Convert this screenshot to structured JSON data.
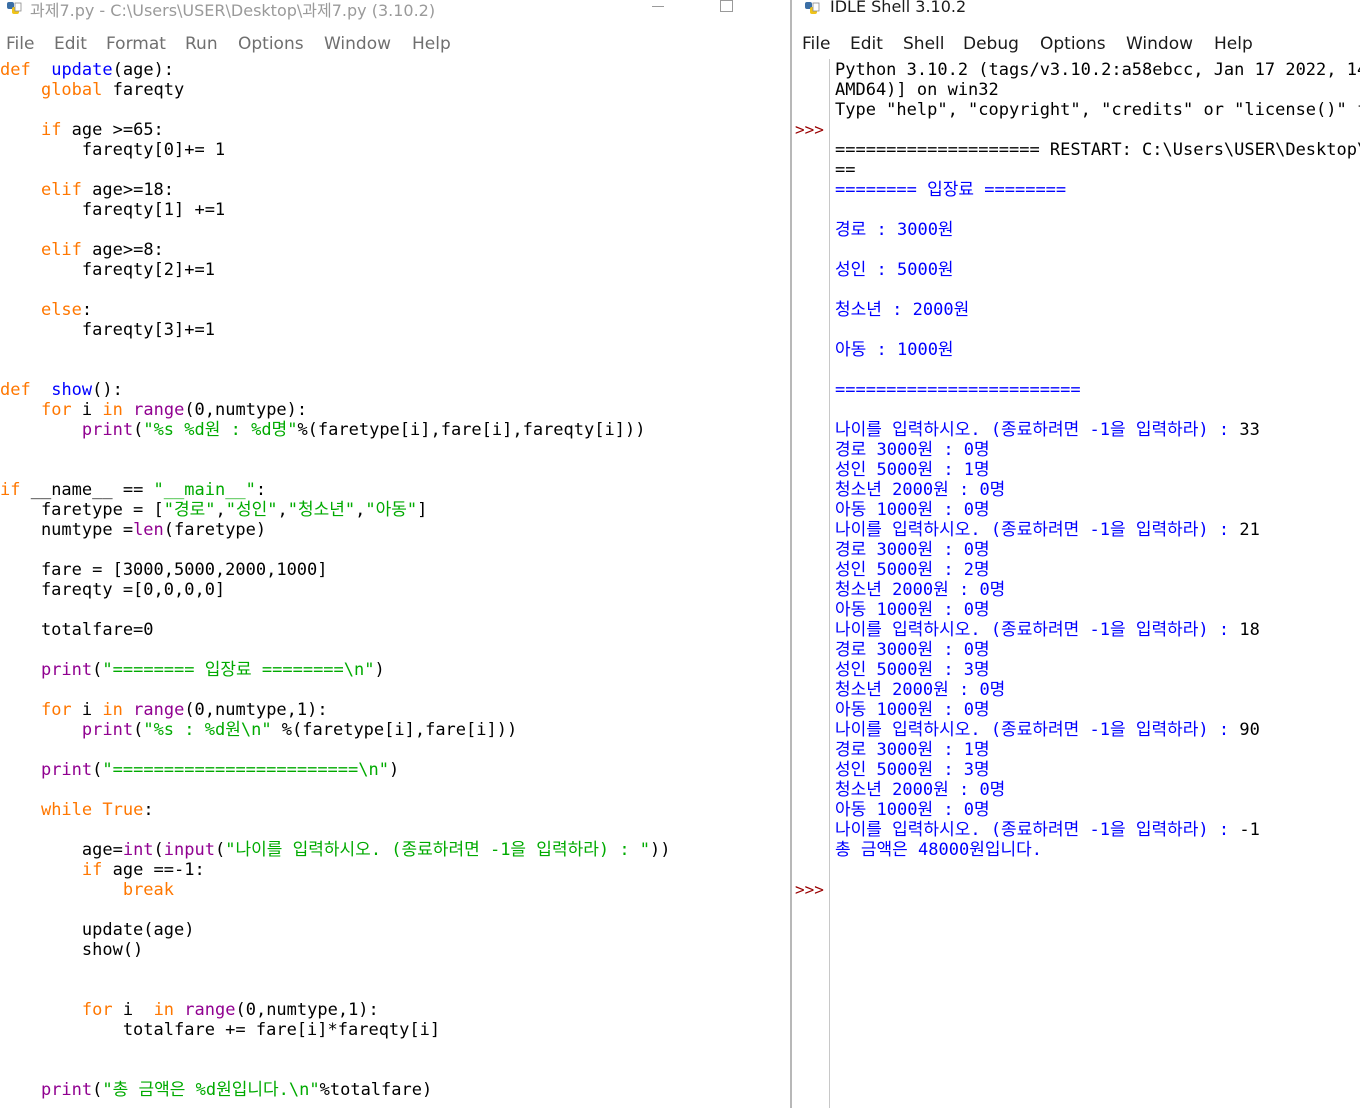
{
  "editor": {
    "title": "과제7.py - C:\\Users\\USER\\Desktop\\과제7.py (3.10.2)",
    "icon": "python-file-icon",
    "menu": [
      "File",
      "Edit",
      "Format",
      "Run",
      "Options",
      "Window",
      "Help"
    ],
    "code": [
      [
        [
          "k",
          "def"
        ],
        [
          "",
          "  "
        ],
        [
          "d",
          "update"
        ],
        [
          "",
          "(age):"
        ]
      ],
      [
        [
          "",
          "    "
        ],
        [
          "k",
          "global"
        ],
        [
          "",
          " fareqty"
        ]
      ],
      [],
      [
        [
          "",
          "    "
        ],
        [
          "k",
          "if"
        ],
        [
          "",
          " age >=65:"
        ]
      ],
      [
        [
          "",
          "        fareqty[0]+= 1"
        ]
      ],
      [],
      [
        [
          "",
          "    "
        ],
        [
          "k",
          "elif"
        ],
        [
          "",
          " age>=18:"
        ]
      ],
      [
        [
          "",
          "        fareqty[1] +=1"
        ]
      ],
      [],
      [
        [
          "",
          "    "
        ],
        [
          "k",
          "elif"
        ],
        [
          "",
          " age>=8:"
        ]
      ],
      [
        [
          "",
          "        fareqty[2]+=1"
        ]
      ],
      [],
      [
        [
          "",
          "    "
        ],
        [
          "k",
          "else"
        ],
        [
          "",
          ":"
        ]
      ],
      [
        [
          "",
          "        fareqty[3]+=1"
        ]
      ],
      [],
      [],
      [
        [
          "k",
          "def"
        ],
        [
          "",
          "  "
        ],
        [
          "d",
          "show"
        ],
        [
          "",
          "():"
        ]
      ],
      [
        [
          "",
          "    "
        ],
        [
          "k",
          "for"
        ],
        [
          "",
          " i "
        ],
        [
          "k",
          "in"
        ],
        [
          "",
          " "
        ],
        [
          "f",
          "range"
        ],
        [
          "",
          "(0,numtype):"
        ]
      ],
      [
        [
          "",
          "        "
        ],
        [
          "f",
          "print"
        ],
        [
          "",
          "("
        ],
        [
          "s",
          "\"%s %d원 : %d명\""
        ],
        [
          "",
          "%(faretype[i],fare[i],fareqty[i]))"
        ]
      ],
      [],
      [],
      [
        [
          "k",
          "if"
        ],
        [
          "",
          " __name__ == "
        ],
        [
          "s",
          "\"__main__\""
        ],
        [
          "",
          ":"
        ]
      ],
      [
        [
          "",
          "    faretype = ["
        ],
        [
          "s",
          "\"경로\""
        ],
        [
          "",
          ","
        ],
        [
          "s",
          "\"성인\""
        ],
        [
          "",
          ","
        ],
        [
          "s",
          "\"청소년\""
        ],
        [
          "",
          ","
        ],
        [
          "s",
          "\"아동\""
        ],
        [
          "",
          "]"
        ]
      ],
      [
        [
          "",
          "    numtype ="
        ],
        [
          "f",
          "len"
        ],
        [
          "",
          "(faretype)"
        ]
      ],
      [],
      [
        [
          "",
          "    fare = [3000,5000,2000,1000]"
        ]
      ],
      [
        [
          "",
          "    fareqty =[0,0,0,0]"
        ]
      ],
      [],
      [
        [
          "",
          "    totalfare=0"
        ]
      ],
      [],
      [
        [
          "",
          "    "
        ],
        [
          "f",
          "print"
        ],
        [
          "",
          "("
        ],
        [
          "s",
          "\"======== 입장료 ========\\n\""
        ],
        [
          "",
          ")"
        ]
      ],
      [],
      [
        [
          "",
          "    "
        ],
        [
          "k",
          "for"
        ],
        [
          "",
          " i "
        ],
        [
          "k",
          "in"
        ],
        [
          "",
          " "
        ],
        [
          "f",
          "range"
        ],
        [
          "",
          "(0,numtype,1):"
        ]
      ],
      [
        [
          "",
          "        "
        ],
        [
          "f",
          "print"
        ],
        [
          "",
          "("
        ],
        [
          "s",
          "\"%s : %d원\\n\""
        ],
        [
          "",
          " %(faretype[i],fare[i]))"
        ]
      ],
      [],
      [
        [
          "",
          "    "
        ],
        [
          "f",
          "print"
        ],
        [
          "",
          "("
        ],
        [
          "s",
          "\"========================\\n\""
        ],
        [
          "",
          ")"
        ]
      ],
      [],
      [
        [
          "",
          "    "
        ],
        [
          "k",
          "while"
        ],
        [
          "",
          " "
        ],
        [
          "k",
          "True"
        ],
        [
          "",
          ":"
        ]
      ],
      [],
      [
        [
          "",
          "        age="
        ],
        [
          "f",
          "int"
        ],
        [
          "",
          "("
        ],
        [
          "f",
          "input"
        ],
        [
          "",
          "("
        ],
        [
          "s",
          "\"나이를 입력하시오. (종료하려면 -1을 입력하라) : \""
        ],
        [
          "",
          "))"
        ]
      ],
      [
        [
          "",
          "        "
        ],
        [
          "k",
          "if"
        ],
        [
          "",
          " age ==-1:"
        ]
      ],
      [
        [
          "",
          "            "
        ],
        [
          "k",
          "break"
        ]
      ],
      [],
      [
        [
          "",
          "        update(age)"
        ]
      ],
      [
        [
          "",
          "        show()"
        ]
      ],
      [],
      [],
      [
        [
          "",
          "        "
        ],
        [
          "k",
          "for"
        ],
        [
          "",
          " i  "
        ],
        [
          "k",
          "in"
        ],
        [
          "",
          " "
        ],
        [
          "f",
          "range"
        ],
        [
          "",
          "(0,numtype,1):"
        ]
      ],
      [
        [
          "",
          "            totalfare += fare[i]*fareqty[i]"
        ]
      ],
      [],
      [],
      [
        [
          "",
          "    "
        ],
        [
          "f",
          "print"
        ],
        [
          "",
          "("
        ],
        [
          "s",
          "\"총 금액은 %d원입니다.\\n\""
        ],
        [
          "",
          "%totalfare)"
        ]
      ]
    ]
  },
  "shell": {
    "title": "IDLE Shell 3.10.2",
    "icon": "python-shell-icon",
    "menu": [
      "File",
      "Edit",
      "Shell",
      "Debug",
      "Options",
      "Window",
      "Help"
    ],
    "prompt_symbol": ">>>",
    "prompt_rows": [
      3,
      41
    ],
    "lines": [
      {
        "c": "std",
        "t": "Python 3.10.2 (tags/v3.10.2:a58ebcc, Jan 17 2022, 14"
      },
      {
        "c": "std",
        "t": "AMD64)] on win32"
      },
      {
        "c": "std",
        "t": "Type \"help\", \"copyright\", \"credits\" or \"license()\" fo"
      },
      {
        "c": "std",
        "t": ""
      },
      {
        "c": "std",
        "t": "==================== RESTART: C:\\Users\\USER\\Desktop\\"
      },
      {
        "c": "std",
        "t": "=="
      },
      {
        "c": "out",
        "t": "======== 입장료 ========"
      },
      {
        "c": "out",
        "t": ""
      },
      {
        "c": "out",
        "t": "경로 : 3000원"
      },
      {
        "c": "out",
        "t": ""
      },
      {
        "c": "out",
        "t": "성인 : 5000원"
      },
      {
        "c": "out",
        "t": ""
      },
      {
        "c": "out",
        "t": "청소년 : 2000원"
      },
      {
        "c": "out",
        "t": ""
      },
      {
        "c": "out",
        "t": "아동 : 1000원"
      },
      {
        "c": "out",
        "t": ""
      },
      {
        "c": "out",
        "t": "========================"
      },
      {
        "c": "out",
        "t": ""
      },
      {
        "c": "out",
        "t": "나이를 입력하시오. (종료하려면 -1을 입력하라) : ",
        "u": "33"
      },
      {
        "c": "out",
        "t": "경로 3000원 : 0명"
      },
      {
        "c": "out",
        "t": "성인 5000원 : 1명"
      },
      {
        "c": "out",
        "t": "청소년 2000원 : 0명"
      },
      {
        "c": "out",
        "t": "아동 1000원 : 0명"
      },
      {
        "c": "out",
        "t": "나이를 입력하시오. (종료하려면 -1을 입력하라) : ",
        "u": "21"
      },
      {
        "c": "out",
        "t": "경로 3000원 : 0명"
      },
      {
        "c": "out",
        "t": "성인 5000원 : 2명"
      },
      {
        "c": "out",
        "t": "청소년 2000원 : 0명"
      },
      {
        "c": "out",
        "t": "아동 1000원 : 0명"
      },
      {
        "c": "out",
        "t": "나이를 입력하시오. (종료하려면 -1을 입력하라) : ",
        "u": "18"
      },
      {
        "c": "out",
        "t": "경로 3000원 : 0명"
      },
      {
        "c": "out",
        "t": "성인 5000원 : 3명"
      },
      {
        "c": "out",
        "t": "청소년 2000원 : 0명"
      },
      {
        "c": "out",
        "t": "아동 1000원 : 0명"
      },
      {
        "c": "out",
        "t": "나이를 입력하시오. (종료하려면 -1을 입력하라) : ",
        "u": "90"
      },
      {
        "c": "out",
        "t": "경로 3000원 : 1명"
      },
      {
        "c": "out",
        "t": "성인 5000원 : 3명"
      },
      {
        "c": "out",
        "t": "청소년 2000원 : 0명"
      },
      {
        "c": "out",
        "t": "아동 1000원 : 0명"
      },
      {
        "c": "out",
        "t": "나이를 입력하시오. (종료하려면 -1을 입력하라) : ",
        "u": "-1"
      },
      {
        "c": "out",
        "t": "총 금액은 48000원입니다."
      },
      {
        "c": "out",
        "t": ""
      }
    ]
  },
  "colors": {
    "keyword": "#ff7700",
    "builtin": "#900090",
    "string": "#00aa00",
    "definition": "#0000ff",
    "shell_output": "#0000ff",
    "prompt": "#990000"
  }
}
